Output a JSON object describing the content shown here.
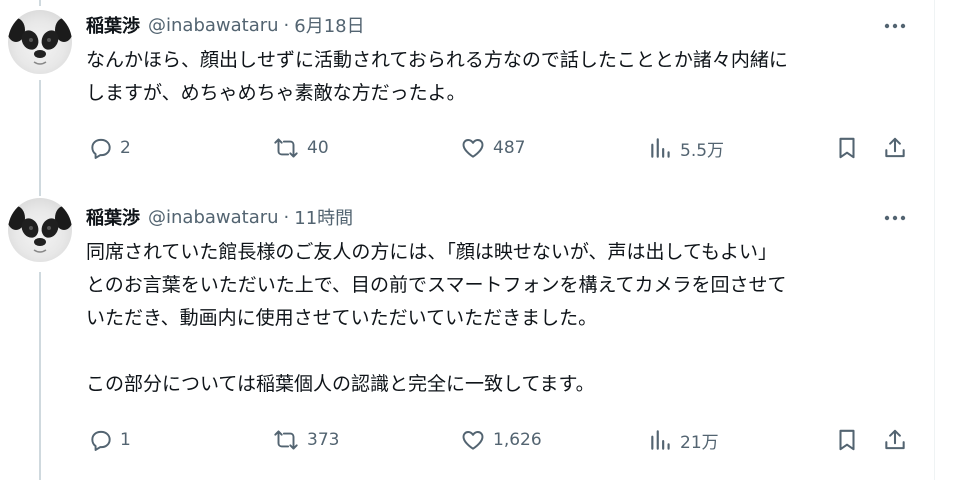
{
  "tweets": [
    {
      "author_name": "稲葉渉",
      "handle": "@inabawataru",
      "separator": "·",
      "time": "6月18日",
      "text_lines": [
        "なんかほら、顔出しせずに活動されておられる方なので話したこととか諸々内緒に",
        "しますが、めちゃめちゃ素敵な方だったよ。"
      ],
      "replies": "2",
      "retweets": "40",
      "likes": "487",
      "views": "5.5万"
    },
    {
      "author_name": "稲葉渉",
      "handle": "@inabawataru",
      "separator": "·",
      "time": "11時間",
      "text_lines": [
        "同席されていた館長様のご友人の方には、「顔は映せないが、声は出してもよい」",
        "とのお言葉をいただいた上で、目の前でスマートフォンを構えてカメラを回させて",
        "いただき、動画内に使用させていただいていただきました。",
        "この部分については稲葉個人の認識と完全に一致してます。"
      ],
      "replies": "1",
      "retweets": "373",
      "likes": "1,626",
      "views": "21万"
    }
  ],
  "icons": {
    "reply": "speech-bubble-icon",
    "retweet": "retweet-arrows-icon",
    "like": "heart-icon",
    "views": "bar-chart-icon",
    "bookmark": "bookmark-icon",
    "share": "share-upload-icon",
    "more": "more-dots-icon"
  },
  "colors": {
    "text_primary": "#0f1419",
    "text_secondary": "#536471",
    "thread_line": "#cfd9de"
  }
}
